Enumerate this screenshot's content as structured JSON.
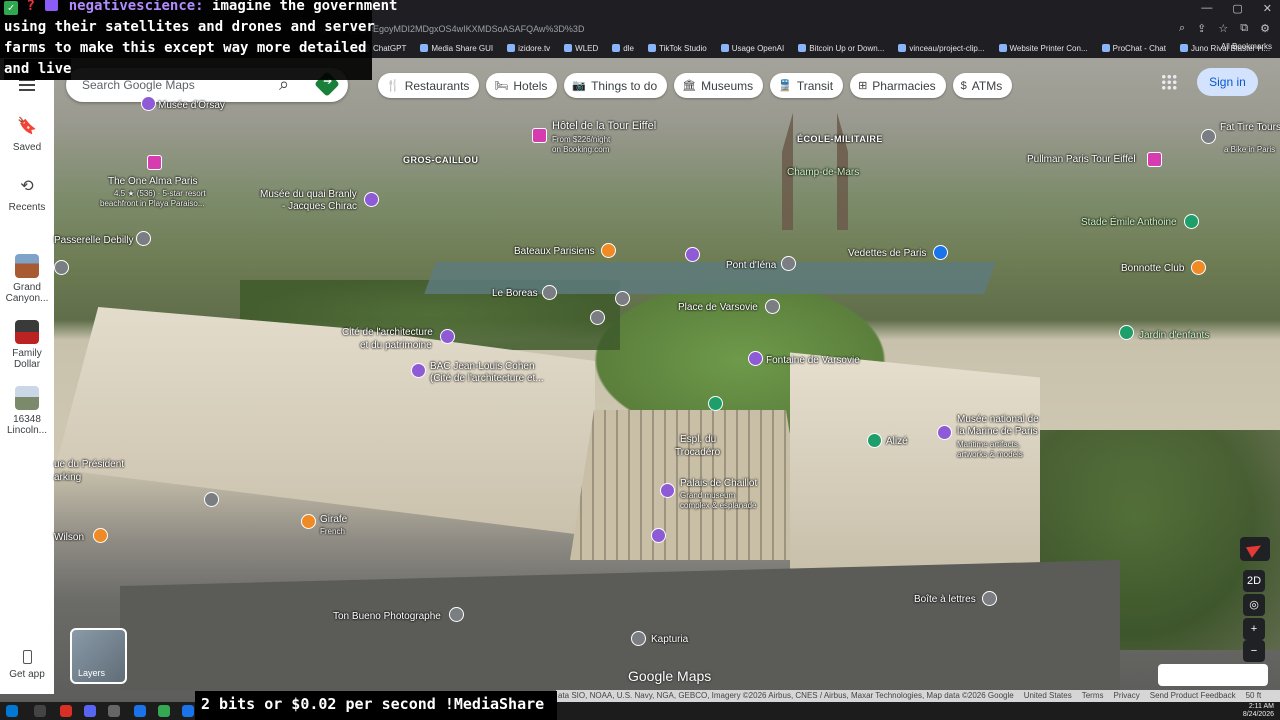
{
  "browser": {
    "url": "ly=ttu&g_ep=EgoyMDI2MDgxOS4wIKXMDSoASAFQAw%3D%3D",
    "bookmarks": [
      "ChatGPT",
      "Media Share GUI",
      "izidore.tv",
      "WLED",
      "dle",
      "TikTok Studio",
      "Usage OpenAI",
      "Bitcoin Up or Down...",
      "vinceau/project-clip...",
      "Website Printer Con...",
      "ProChat - Chat",
      "Juno Rival Blaster H..."
    ],
    "all_bookmarks": "All Bookmarks"
  },
  "chat": {
    "username": "negativescience:",
    "message_lines": [
      "imagine the government",
      "using their satellites and drones and server",
      "farms to make this except way more detailed",
      "and live"
    ]
  },
  "rail": {
    "saved": "Saved",
    "recents": "Recents",
    "recent_items": [
      {
        "label_1": "Grand",
        "label_2": "Canyon..."
      },
      {
        "label_1": "Family",
        "label_2": "Dollar"
      },
      {
        "label_1": "16348",
        "label_2": "Lincoln..."
      }
    ],
    "get_app": "Get app"
  },
  "search": {
    "placeholder": "Search Google Maps"
  },
  "chips": [
    {
      "icon": "restaurant-icon",
      "label": "Restaurants"
    },
    {
      "icon": "hotel-icon",
      "label": "Hotels"
    },
    {
      "icon": "camera-icon",
      "label": "Things to do"
    },
    {
      "icon": "museum-icon",
      "label": "Museums"
    },
    {
      "icon": "transit-icon",
      "label": "Transit"
    },
    {
      "icon": "pharmacy-icon",
      "label": "Pharmacies"
    },
    {
      "icon": "atm-icon",
      "label": "ATMs"
    }
  ],
  "signin": "Sign in",
  "places": {
    "musee_orsay": "Musée d'Orsay",
    "hotel_tour_eiffel": "Hôtel de la Tour Eiffel",
    "hotel_tour_eiffel_sub1": "From $226/night",
    "hotel_tour_eiffel_sub2": "on Booking.com",
    "ecole_militaire": "ÉCOLE-MILITAIRE",
    "champ_de_mars": "Champ-de-Mars",
    "gros_caillou": "GROS-CAILLOU",
    "one_alma": "The One Alma Paris",
    "one_alma_sub1": "4.5 ★ (536) · 5-star resort",
    "one_alma_sub2": "beachfront in Playa Paraiso...",
    "musee_quai_branly_1": "Musée du quai Branly",
    "musee_quai_branly_2": "- Jacques Chirac",
    "passerelle": "Passerelle Debilly",
    "pullman": "Pullman Paris Tour Eiffel",
    "fat_tire_1": "Fat Tire Tours",
    "fat_tire_2": "a Bike in Paris",
    "stade": "Stade Émile Anthoine",
    "bateaux": "Bateaux Parisiens",
    "pont_iena": "Pont d'Iéna",
    "vedettes": "Vedettes de Paris",
    "bonnotte": "Bonnotte Club",
    "le_boreas": "Le Boreas",
    "place_varsovie": "Place de Varsovie",
    "jardin_enfants": "Jardin d'enfants",
    "cite_archi_1": "Cité de l'architecture",
    "cite_archi_2": "et du patrimoine",
    "bac_1": "BAC Jean-Louis Cohen",
    "bac_2": "(Cité de l'architecture et...",
    "fontaine": "Fontaine de Varsovie",
    "esplanade_1": "Espl. du",
    "esplanade_2": "Trocadéro",
    "alize": "Alizé",
    "musee_marine_1": "Musée national de",
    "musee_marine_2": "la Marine de Paris",
    "musee_marine_3": "Maritime artifacts,",
    "musee_marine_4": "artworks & models",
    "president_1": "ue du Président",
    "president_2": "arking",
    "chaillot_1": "Palais de Chaillot",
    "chaillot_2": "Grand museum",
    "chaillot_3": "complex & esplanade",
    "girafe_1": "Girafe",
    "girafe_2": "French",
    "wilson": "Wilson",
    "boite": "Boîte à lettres",
    "ton_bueno": "Ton Bueno Photographe",
    "kapturia": "Kapturia"
  },
  "controls": {
    "mode_2d": "2D",
    "zoom_in": "+",
    "zoom_out": "−"
  },
  "layers": "Layers",
  "logo": "Google Maps",
  "attribution": {
    "data": "ata SIO, NOAA, U.S. Navy, NGA, GEBCO, Imagery ©2026 Airbus, CNES / Airbus, Maxar Technologies, Map data ©2026 Google",
    "links": [
      "United States",
      "Terms",
      "Privacy",
      "Send Product Feedback"
    ],
    "scale": "50 ft"
  },
  "ticker": "2 bits or $0.02 per second !MediaShare",
  "clock": {
    "time": "2:11 AM",
    "date": "8/24/2026"
  }
}
